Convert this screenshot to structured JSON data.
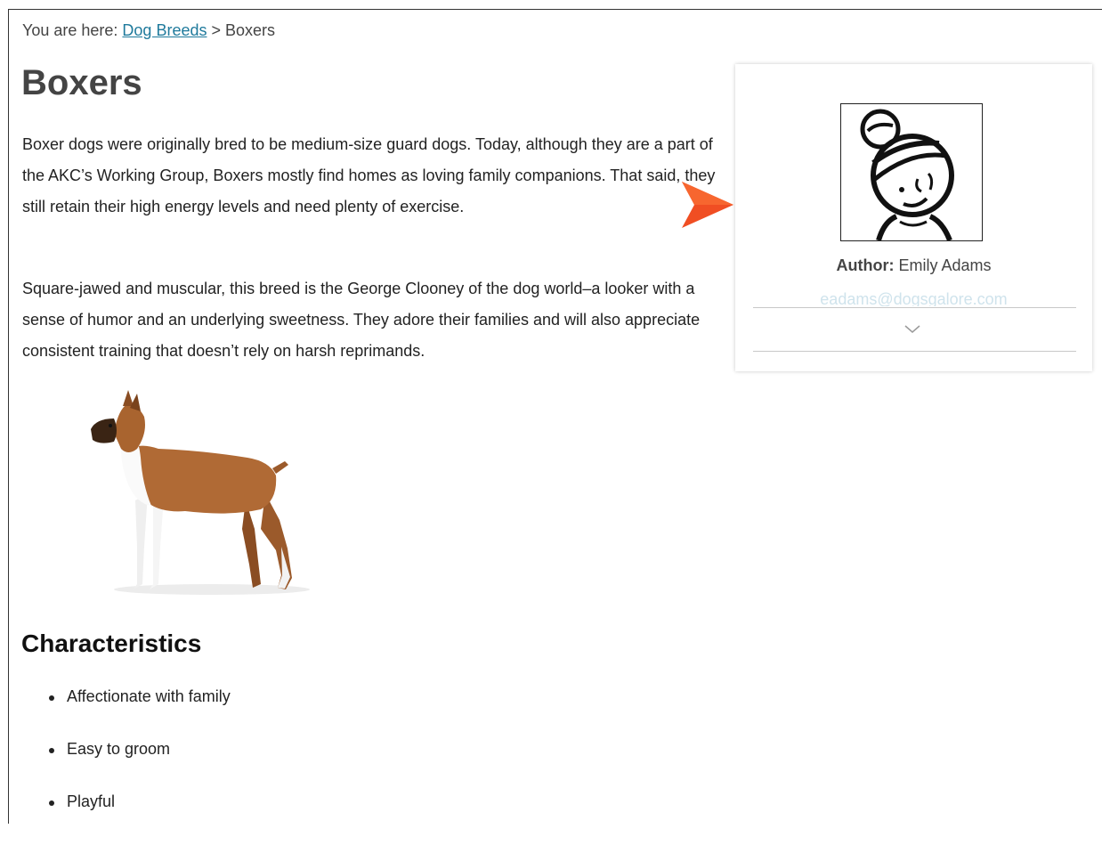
{
  "breadcrumb": {
    "prefix": "You are here: ",
    "link": "Dog Breeds",
    "separator": " > ",
    "current": "Boxers"
  },
  "page": {
    "title": "Boxers",
    "paragraphs": [
      "Boxer dogs were originally bred to be medium-size guard dogs. Today, although they are a part of the AKC’s Working Group, Boxers mostly find homes as loving family companions. That said, they still retain their high energy levels and need plenty of exercise.",
      "Square-jawed and muscular, this breed is the George Clooney of the dog world–a looker with a sense of humor and an underlying sweetness. They adore their families and will also appreciate consistent training that doesn’t rely on harsh reprimands."
    ]
  },
  "characteristics": {
    "heading": "Characteristics",
    "items": [
      "Affectionate with family",
      "Easy to groom",
      "Playful"
    ]
  },
  "author_card": {
    "label": "Author:",
    "name": " Emily Adams",
    "email": "eadams@dogsgalore.com",
    "expand_icon": "chevron-down-icon"
  },
  "colors": {
    "link": "#1f7a9c",
    "arrow": "#f04e23",
    "heading": "#444444"
  }
}
